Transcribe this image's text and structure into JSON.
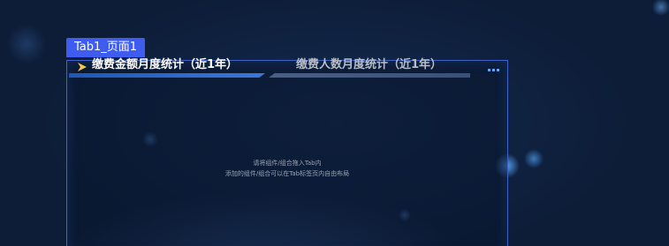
{
  "page_tab": {
    "label": "Tab1_页面1"
  },
  "tabs": [
    {
      "label": "缴费金额月度统计（近1年）",
      "active": true
    },
    {
      "label": "缴费人数月度统计（近1年）",
      "active": false
    }
  ],
  "placeholder": {
    "line1": "请将组件/组合拖入Tab内",
    "line2": "添加的组件/组合可以在Tab标签页内自由布局"
  },
  "colors": {
    "page_tab_bg": "#3e5cf0",
    "active_tab_text": "#ffffff",
    "inactive_tab_text": "#b7bdc8",
    "panel_border": "#3f63c7",
    "accent_arrow": "#f2c94c"
  },
  "icons": {
    "active_tab_marker": "arrow-icon",
    "header_decoration": "dots-icon"
  }
}
